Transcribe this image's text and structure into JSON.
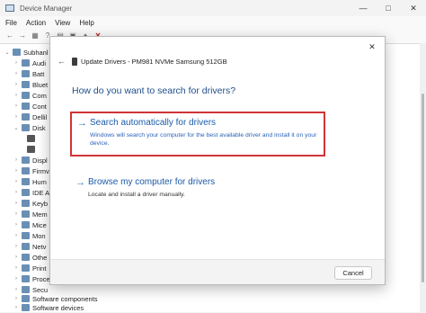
{
  "window": {
    "title": "Device Manager",
    "controls": [
      "—",
      "□",
      "✕"
    ]
  },
  "menu": [
    "File",
    "Action",
    "View",
    "Help"
  ],
  "toolbar_icons": [
    "back-icon",
    "forward-icon",
    "properties-icon",
    "help-icon",
    "scan-icon",
    "update-icon",
    "plug-icon",
    "uninstall-icon"
  ],
  "tree": [
    {
      "label": "Subhanl",
      "chevron": "⌄"
    },
    {
      "label": "Audi",
      "chevron": "›"
    },
    {
      "label": "Batt",
      "chevron": "›"
    },
    {
      "label": "Bluet",
      "chevron": "›"
    },
    {
      "label": "Com",
      "chevron": "›"
    },
    {
      "label": "Cont",
      "chevron": "›"
    },
    {
      "label": "Dellil",
      "chevron": "›"
    },
    {
      "label": "Disk",
      "chevron": "⌄"
    },
    {
      "label": "",
      "chevron": ""
    },
    {
      "label": "",
      "chevron": ""
    },
    {
      "label": "Displ",
      "chevron": "›"
    },
    {
      "label": "Firmv",
      "chevron": "›"
    },
    {
      "label": "Hum",
      "chevron": "›"
    },
    {
      "label": "IDE A",
      "chevron": "›"
    },
    {
      "label": "Keyb",
      "chevron": "›"
    },
    {
      "label": "Mem",
      "chevron": "›"
    },
    {
      "label": "Mice",
      "chevron": "›"
    },
    {
      "label": "Mon",
      "chevron": "›"
    },
    {
      "label": "Netv",
      "chevron": "›"
    },
    {
      "label": "Othe",
      "chevron": "›"
    },
    {
      "label": "Print",
      "chevron": "›"
    },
    {
      "label": "Proce",
      "chevron": "›"
    },
    {
      "label": "Secu",
      "chevron": "›"
    },
    {
      "label": "Software components",
      "chevron": "›"
    },
    {
      "label": "Software devices",
      "chevron": "›"
    }
  ],
  "dialog": {
    "back": "←",
    "close": "✕",
    "header": "Update Drivers - PM981 NVMe Samsung 512GB",
    "question": "How do you want to search for drivers?",
    "option_auto": {
      "arrow": "→",
      "title": "Search automatically for drivers",
      "description": "Windows will search your computer for the best available driver and install it on your device."
    },
    "option_browse": {
      "arrow": "→",
      "title": "Browse my computer for drivers",
      "description": "Locate and install a driver manually."
    },
    "cancel_label": "Cancel"
  },
  "colors": {
    "accent": "#1a5aa8",
    "highlight": "#d13438"
  }
}
